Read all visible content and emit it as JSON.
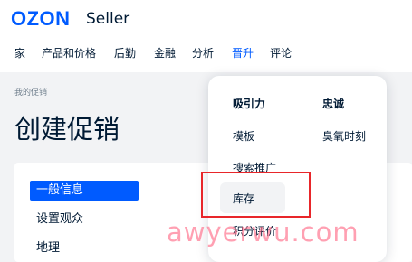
{
  "header": {
    "logo": "OZON",
    "product": "Seller"
  },
  "nav": {
    "items": [
      "家",
      "产品和价格",
      "后勤",
      "金融",
      "分析",
      "晋升",
      "评论"
    ],
    "active": "晋升"
  },
  "breadcrumb": "我的促销",
  "page_title": "创建促销",
  "steps": [
    "一般信息",
    "设置观众",
    "地理"
  ],
  "dropdown": {
    "col1_title": "吸引力",
    "col2_title": "忠诚",
    "col1_items": [
      "模板",
      "搜索推广",
      "库存",
      "积分评价"
    ],
    "col2_items": [
      "臭氧时刻"
    ]
  },
  "watermark": "awyerwu.com",
  "colors": {
    "accent": "#005bff",
    "highlight_border": "#e8262a",
    "page_bg": "#f2f3f5"
  }
}
